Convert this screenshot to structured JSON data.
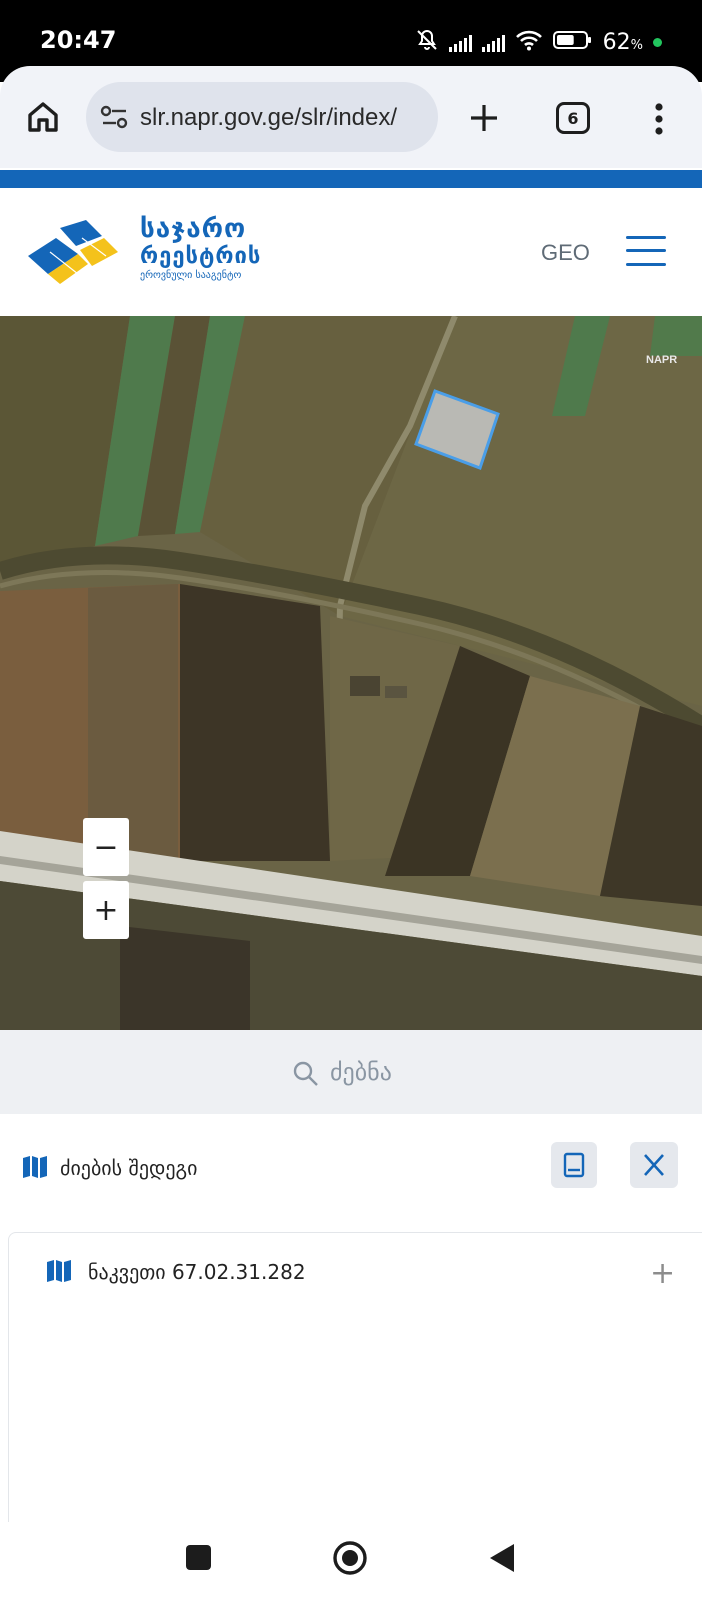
{
  "status_bar": {
    "time": "20:47",
    "battery_percent": "62",
    "battery_unit": "%",
    "battery_level": 0.62,
    "icons": [
      "bell-off-icon",
      "signal-icon",
      "signal-icon",
      "wifi-icon",
      "battery-icon"
    ],
    "dot_color": "#22c55e"
  },
  "browser": {
    "url": "slr.napr.gov.ge/slr/index/",
    "tab_count": "6",
    "icons": [
      "home-icon",
      "site-settings-icon",
      "new-tab-icon",
      "tabs-icon",
      "more-menu-icon"
    ]
  },
  "header": {
    "brand_line1": "საჯარო",
    "brand_line2": "რეესტრის",
    "brand_line3": "ეროვნული სააგენტო",
    "language": "GEO",
    "accent_color": "#1466b8",
    "logo_yellow": "#f4c21b"
  },
  "map": {
    "watermark": "NAPR",
    "zoom_out_label": "−",
    "zoom_in_label": "+",
    "parcel_highlight_color": "#4a9ee8"
  },
  "search": {
    "label": "ძებნა",
    "icon": "search-icon"
  },
  "results": {
    "header_label": "ძიების შედეგი",
    "items": [
      {
        "label": "ნაკვეთი 67.02.31.282",
        "icon": "map-icon",
        "action": "+"
      }
    ]
  },
  "nav_bar": {
    "icons": [
      "recents-icon",
      "home-icon",
      "back-icon"
    ]
  }
}
